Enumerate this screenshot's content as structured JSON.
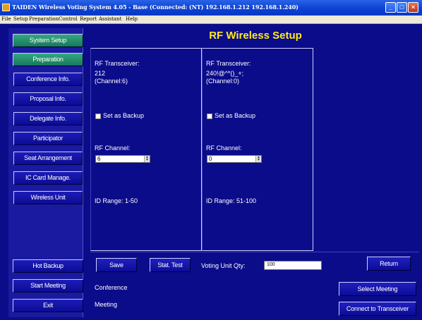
{
  "window": {
    "title": "TAIDEN Wireless Voting System 4.05 - Base (Connected: (NT) 192.168.1.212 192.168.1.240)",
    "controls": {
      "minimize_icon": "minimize-icon",
      "maximize_icon": "maximize-icon",
      "close_icon": "close-icon"
    }
  },
  "menu": [
    "File",
    "Setup",
    "Preparation",
    "Control",
    "Report",
    "Assistant",
    "Help"
  ],
  "sidebar": {
    "system_setup": "System Setup",
    "preparation": "Preparation",
    "items": [
      "Conference Info.",
      "Proposal Info.",
      "Delegate Info.",
      "Participator",
      "Seat Arrangement",
      "IC Card Manage.",
      "Wireless Unit"
    ],
    "hot_backup": "Hot Backup",
    "start_meeting": "Start Meeting",
    "exit": "Exit"
  },
  "page_title": "RF Wireless Setup",
  "transceivers": [
    {
      "header": "RF Transceiver:",
      "name": "212",
      "channel": "(Channel:6)",
      "backup_label": "Set as Backup",
      "backup_checked": false,
      "rf_channel_label": "RF Channel:",
      "rf_channel_value": "6",
      "id_range": "ID Range:  1-50"
    },
    {
      "header": "RF Transceiver:",
      "name": "240!@^*()_+;",
      "channel": "(Channel:0)",
      "backup_label": "Set as Backup",
      "backup_checked": false,
      "rf_channel_label": "RF Channel:",
      "rf_channel_value": "0",
      "id_range": "ID Range:  51-100"
    }
  ],
  "actions": {
    "save": "Save",
    "stat_test": "Stat. Test",
    "voting_unit_qty_label": "Voting Unit Qty:",
    "voting_unit_qty_value": "100",
    "return": "Return",
    "select_meeting": "Select Meeting",
    "connect": "Connect to Transceiver"
  },
  "status": {
    "conference_label": "Conference",
    "meeting_label": "Meeting"
  },
  "colors": {
    "background": "#0b0c8a",
    "title_accent": "#ffeb1a",
    "nav_green": "#1f8a66",
    "titlebar_blue": "#0a3fd0"
  }
}
